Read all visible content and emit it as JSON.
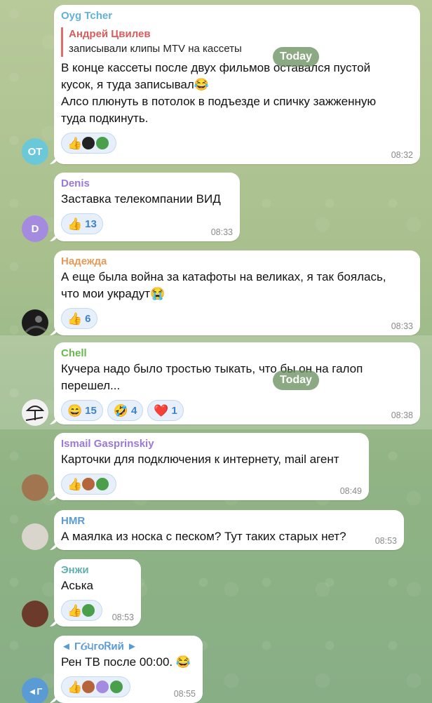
{
  "date_badge": "Today",
  "messages": [
    {
      "author": "Oyg Tcher",
      "author_color": "#63b1d8",
      "avatar_initials": "OT",
      "avatar_color": "#6ac8d8",
      "reply": {
        "author": "Андрей Цвилев",
        "text": "записывали клипы MTV на кассеты"
      },
      "lines": [
        "В конце кассеты после двух фильмов оставался пустой",
        "кусок, я туда записывал😂",
        "Алсо плюнуть в потолок в подъезде и спичку зажженную",
        "туда подкинуть."
      ],
      "reactions": [
        {
          "emoji": "👍",
          "count": "",
          "users": 2
        }
      ],
      "time": "08:32"
    },
    {
      "author": "Denis",
      "author_color": "#9a7ad6",
      "avatar_initials": "D",
      "avatar_color": "#a58be0",
      "lines": [
        "Заставка телекомпании ВИД"
      ],
      "reactions": [
        {
          "emoji": "👍",
          "count": "13",
          "users": 0
        }
      ],
      "time": "08:33"
    },
    {
      "author": "Надежда",
      "author_color": "#e79a58",
      "avatar_initials": "",
      "avatar_color": "#1b1b1b",
      "lines": [
        "А еще была война за катафоты на великах, я так боялась,",
        "что мои украдут😭"
      ],
      "reactions": [
        {
          "emoji": "👍",
          "count": "6",
          "users": 0
        }
      ],
      "time": "08:33"
    },
    {
      "author": "Chell",
      "author_color": "#67b84e",
      "avatar_initials": "",
      "avatar_color": "#f2f2f2",
      "lines": [
        "Кучера надо было тростью тыкать, что бы он на галоп",
        "перешел..."
      ],
      "reactions": [
        {
          "emoji": "😄",
          "count": "15",
          "users": 0
        },
        {
          "emoji": "🤣",
          "count": "4",
          "users": 0
        },
        {
          "emoji": "❤️",
          "count": "1",
          "users": 0
        }
      ],
      "time": "08:38"
    },
    {
      "author": "Ismail Gasprinskiy",
      "author_color": "#9a7ad6",
      "avatar_initials": "",
      "avatar_color": "#a1754f",
      "lines": [
        "Карточки для подключения к интернету, mail агент"
      ],
      "reactions": [
        {
          "emoji": "👍",
          "count": "",
          "users": 2
        }
      ],
      "time": "08:49"
    },
    {
      "author": "HMR",
      "author_color": "#5a9bd6",
      "avatar_initials": "",
      "avatar_color": "#d9d4cc",
      "lines": [
        "А маялка из носка с песком? Тут таких старых нет?"
      ],
      "reactions": [],
      "time": "08:53"
    },
    {
      "author": "Энжи",
      "author_color": "#5fb0b0",
      "avatar_initials": "",
      "avatar_color": "#6b3a2a",
      "lines": [
        "Аська"
      ],
      "reactions": [
        {
          "emoji": "👍",
          "count": "",
          "users": 1
        }
      ],
      "time": "08:53"
    },
    {
      "author": "◄ ΓᏵ੫гоᏒий ►",
      "author_color": "#5a9bd6",
      "avatar_initials": "◄Γ",
      "avatar_color": "#5a9bd6",
      "lines": [
        "Рен ТВ после 00:00. 😂"
      ],
      "reactions": [
        {
          "emoji": "👍",
          "count": "",
          "users": 3
        }
      ],
      "time": "08:55"
    }
  ]
}
